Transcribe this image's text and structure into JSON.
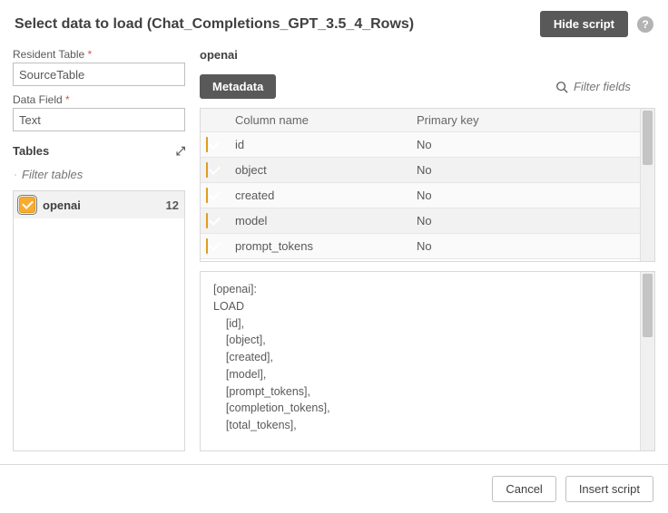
{
  "header": {
    "title": "Select data to load (Chat_Completions_GPT_3.5_4_Rows)",
    "hide_script": "Hide script",
    "help": "?"
  },
  "form": {
    "resident_label": "Resident Table",
    "resident_value": "SourceTable",
    "datafield_label": "Data Field",
    "datafield_value": "Text",
    "required_marker": "*"
  },
  "tables": {
    "section_label": "Tables",
    "filter_placeholder": "Filter tables",
    "items": [
      {
        "name": "openai",
        "count": "12",
        "selected": true
      }
    ]
  },
  "right": {
    "title": "openai",
    "metadata_tab": "Metadata",
    "filter_fields_placeholder": "Filter fields",
    "columns": {
      "name": "Column name",
      "pk": "Primary key"
    },
    "rows": [
      {
        "name": "id",
        "pk": "No",
        "checked": true
      },
      {
        "name": "object",
        "pk": "No",
        "checked": true
      },
      {
        "name": "created",
        "pk": "No",
        "checked": true
      },
      {
        "name": "model",
        "pk": "No",
        "checked": true
      },
      {
        "name": "prompt_tokens",
        "pk": "No",
        "checked": true
      }
    ]
  },
  "script_preview": "[openai]:\nLOAD\n    [id],\n    [object],\n    [created],\n    [model],\n    [prompt_tokens],\n    [completion_tokens],\n    [total_tokens],",
  "footer": {
    "cancel": "Cancel",
    "insert": "Insert script"
  }
}
